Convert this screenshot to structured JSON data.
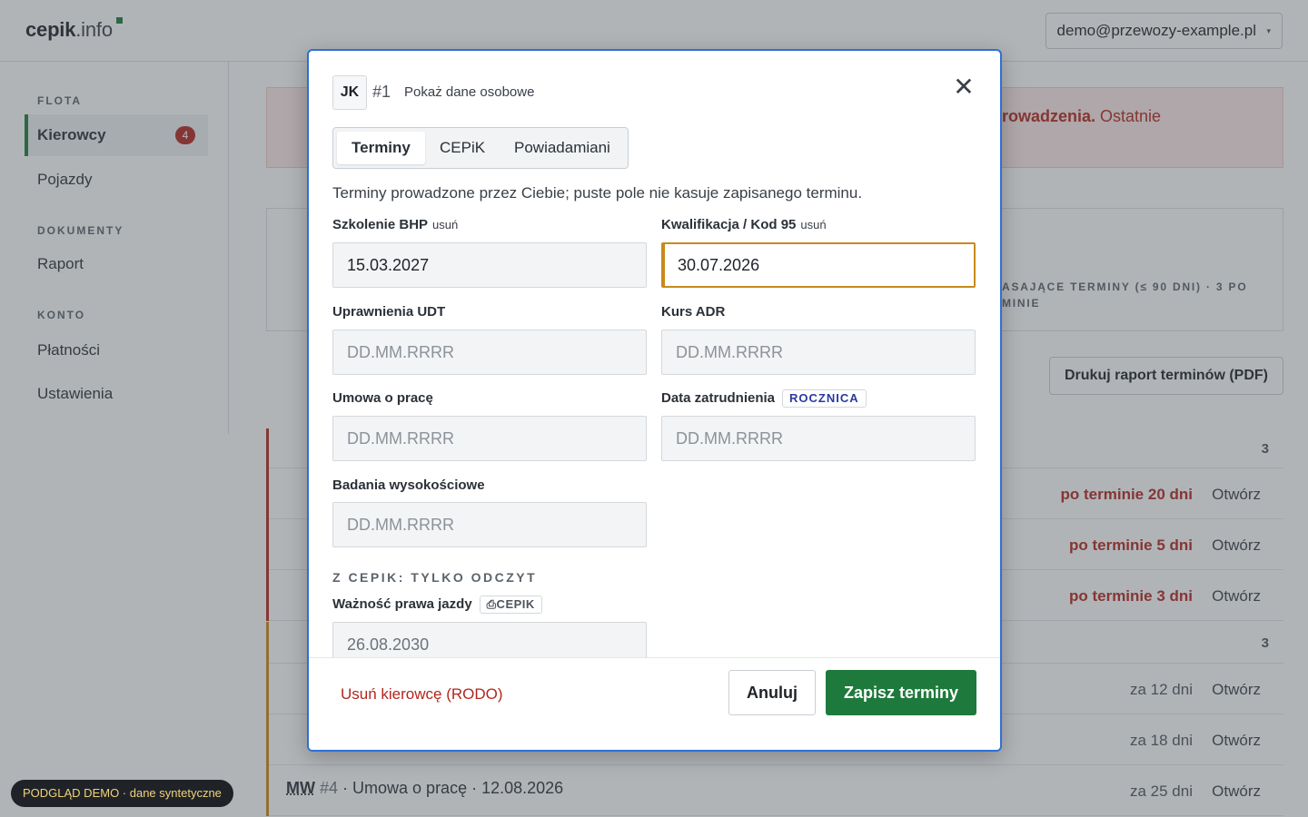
{
  "app": {
    "logo_main": "cepik",
    "logo_accent": ".info",
    "account_email": "demo@przewozy-example.pl"
  },
  "sidebar": {
    "sections": [
      {
        "label": "FLOTA",
        "items": [
          {
            "label": "Kierowcy",
            "badge": "4",
            "active": true
          },
          {
            "label": "Pojazdy"
          }
        ]
      },
      {
        "label": "DOKUMENTY",
        "items": [
          {
            "label": "Raport"
          }
        ]
      },
      {
        "label": "KONTO",
        "items": [
          {
            "label": "Płatności"
          },
          {
            "label": "Ustawienia"
          }
        ]
      }
    ]
  },
  "background": {
    "alert_bold": "rowadzenia.",
    "alert_rest": " Ostatnie",
    "stat_right_text": "ASAJĄCE TERMINY (≤ 90 DNI) · 3 PO MINIE",
    "print_button": "Drukuj raport terminów (PDF)",
    "overdue_count": "3",
    "upcoming_count": "3",
    "overdue_rows": [
      {
        "status": "po terminie 20 dni",
        "action": "Otwórz"
      },
      {
        "status": "po terminie 5 dni",
        "action": "Otwórz"
      },
      {
        "status": "po terminie 3 dni",
        "action": "Otwórz"
      }
    ],
    "upcoming_rows": [
      {
        "status": "za 12 dni",
        "action": "Otwórz"
      },
      {
        "status": "za 18 dni",
        "action": "Otwórz"
      },
      {
        "status": "za 25 dni",
        "action": "Otwórz",
        "initials": "MW",
        "num": "#4",
        "detail": " · Umowa o pracę · 12.08.2026"
      }
    ]
  },
  "demo_pill": "PODGLĄD DEMO · dane syntetyczne",
  "modal": {
    "initials": "JK",
    "driver_num": "#1",
    "show_personal": "Pokaż dane osobowe",
    "close": "✕",
    "tabs": [
      "Terminy",
      "CEPiK",
      "Powiadamiani"
    ],
    "helper": "Terminy prowadzone przez Ciebie; puste pole nie kasuje zapisanego terminu.",
    "fields": {
      "bhp": {
        "label": "Szkolenie BHP",
        "remove": "usuń",
        "value": "15.03.2027"
      },
      "kod95": {
        "label": "Kwalifikacja / Kod 95",
        "remove": "usuń",
        "value": "30.07.2026"
      },
      "udt": {
        "label": "Uprawnienia UDT",
        "placeholder": "DD.MM.RRRR"
      },
      "adr": {
        "label": "Kurs ADR",
        "placeholder": "DD.MM.RRRR"
      },
      "umowa": {
        "label": "Umowa o pracę",
        "placeholder": "DD.MM.RRRR"
      },
      "zatrudnienie": {
        "label": "Data zatrudnienia",
        "tag": "ROCZNICA",
        "placeholder": "DD.MM.RRRR"
      },
      "wysokosciowe": {
        "label": "Badania wysokościowe",
        "placeholder": "DD.MM.RRRR"
      },
      "prawo_jazdy": {
        "label": "Ważność prawa jazdy",
        "tag": "⎙CEPIK",
        "value": "26.08.2030"
      }
    },
    "readonly_section": "Z CEPIK: TYLKO ODCZYT",
    "delete_link": "Usuń kierowcę (RODO)",
    "cancel": "Anuluj",
    "save": "Zapisz terminy"
  },
  "colors": {
    "accent_green": "#1e7a3c",
    "danger_red": "#b3261e",
    "focus_amber": "#c98a1b",
    "modal_border": "#2f6fd6",
    "tag_blue": "#2a3aa0"
  }
}
